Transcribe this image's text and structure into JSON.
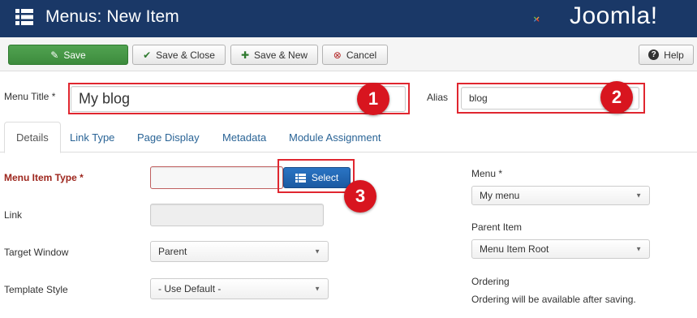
{
  "header": {
    "title": "Menus: New Item",
    "logo_text": "Joomla!"
  },
  "toolbar": {
    "save_label": "Save",
    "save_close_label": "Save & Close",
    "save_new_label": "Save & New",
    "cancel_label": "Cancel",
    "help_label": "Help"
  },
  "title_row": {
    "menu_title_label": "Menu Title *",
    "menu_title_value": "My blog",
    "alias_label": "Alias",
    "alias_value": "blog"
  },
  "tabs": [
    {
      "label": "Details",
      "active": true
    },
    {
      "label": "Link Type"
    },
    {
      "label": "Page Display"
    },
    {
      "label": "Metadata"
    },
    {
      "label": "Module Assignment"
    }
  ],
  "details": {
    "menu_item_type_label": "Menu Item Type *",
    "menu_item_type_value": "",
    "select_button_label": "Select",
    "link_label": "Link",
    "link_value": "",
    "target_window_label": "Target Window",
    "target_window_value": "Parent",
    "template_style_label": "Template Style",
    "template_style_value": "- Use Default -"
  },
  "sidebar": {
    "menu_label": "Menu *",
    "menu_value": "My menu",
    "parent_item_label": "Parent Item",
    "parent_item_value": "Menu Item Root",
    "ordering_label": "Ordering",
    "ordering_note": "Ordering will be available after saving."
  },
  "annotations": [
    "1",
    "2",
    "3"
  ],
  "colors": {
    "header_bg": "#1a3867",
    "save_green": "#46a046",
    "select_blue": "#2166b6",
    "annotation_red": "#d8151f",
    "required_label": "#9d261d"
  }
}
